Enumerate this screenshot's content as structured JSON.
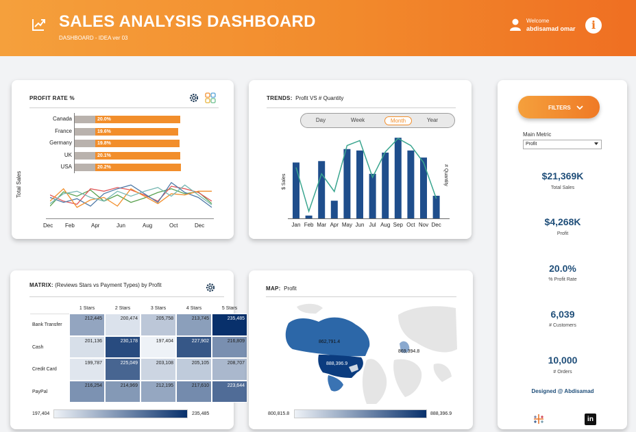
{
  "header": {
    "title": "SALES ANALYSIS DASHBOARD",
    "subtitle": "DASHBOARD - IDEA ver 03",
    "welcome": "Welcome",
    "username": "abdisamad omar",
    "info_icon": "i"
  },
  "profit_rate": {
    "title": "PROFIT RATE %",
    "countries": [
      "Canada",
      "France",
      "Germany",
      "UK",
      "USA"
    ],
    "labels": [
      "20.0%",
      "19.6%",
      "19.8%",
      "20.1%",
      "20.2%"
    ],
    "values": [
      20.0,
      19.6,
      19.8,
      20.1,
      20.2
    ],
    "xlabel_ticks": [
      "Dec",
      "Feb",
      "Apr",
      "Jun",
      "Aug",
      "Oct",
      "Dec"
    ],
    "ylabel": "Total Sales",
    "series_colors": [
      "#59a14f",
      "#e15759",
      "#4e79a7",
      "#f28e2b",
      "#76b7b2"
    ]
  },
  "trends": {
    "title_bold": "TRENDS:",
    "title_rest": "Profit VS  # Quantity",
    "segments": [
      "Day",
      "Week",
      "Month",
      "Year"
    ],
    "active_segment": "Month",
    "months": [
      "Jan",
      "Feb",
      "Mar",
      "Apr",
      "May",
      "Jun",
      "Jul",
      "Aug",
      "Sep",
      "Oct",
      "Nov",
      "Dec"
    ],
    "y_left_label": "$ Sales",
    "y_right_label": "# Quantity"
  },
  "matrix": {
    "title_bold": "MATRIX:",
    "title_rest": "(Reviews Stars vs Payment Types) by Profit",
    "columns": [
      "1 Stars",
      "2 Stars",
      "3 Stars",
      "4 Stars",
      "5 Stars"
    ],
    "rows": [
      "Bank Transfer",
      "Cash",
      "Credit Card",
      "PayPal"
    ],
    "values": [
      [
        "212,445",
        "200,474",
        "205,758",
        "213,745",
        "235,485"
      ],
      [
        "201,136",
        "230,178",
        "197,404",
        "227,902",
        "216,809"
      ],
      [
        "199,787",
        "225,049",
        "203,108",
        "205,105",
        "208,707"
      ],
      [
        "216,254",
        "214,969",
        "212,195",
        "217,610",
        "223,644"
      ]
    ],
    "legend_min": "197,404",
    "legend_max": "235,485"
  },
  "map": {
    "title_bold": "MAP:",
    "title_rest": "Profit",
    "label_canada": "862,791.4",
    "label_usa": "888,396.9",
    "label_europe": "869,394.8",
    "legend_min": "800,815.8",
    "legend_max": "888,396.9"
  },
  "filters": {
    "button_label": "FILTERS",
    "main_metric_label": "Main Metric",
    "main_metric_value": "Profit"
  },
  "kpis": [
    {
      "value": "$21,369K",
      "label": "Total Sales"
    },
    {
      "value": "$4,268K",
      "label": "Profit"
    },
    {
      "value": "20.0%",
      "label": "% Profit Rate"
    },
    {
      "value": "6,039",
      "label": "# Customers"
    },
    {
      "value": "10,000",
      "label": "# Orders"
    }
  ],
  "credit": "Designed @ Abdisamad",
  "chart_data": [
    {
      "type": "bar",
      "title": "PROFIT RATE %",
      "categories": [
        "Canada",
        "France",
        "Germany",
        "UK",
        "USA"
      ],
      "values": [
        20.0,
        19.6,
        19.8,
        20.1,
        20.2
      ],
      "orientation": "horizontal"
    },
    {
      "type": "bar",
      "title": "TRENDS: Profit VS # Quantity",
      "categories": [
        "Jan",
        "Feb",
        "Mar",
        "Apr",
        "May",
        "Jun",
        "Jul",
        "Aug",
        "Sep",
        "Oct",
        "Nov",
        "Dec"
      ],
      "series": [
        {
          "name": "$ Sales",
          "values": [
            79,
            4,
            81,
            25,
            98,
            96,
            63,
            93,
            114,
            96,
            86,
            32
          ]
        },
        {
          "name": "# Quantity",
          "values": [
            72,
            10,
            63,
            38,
            103,
            110,
            58,
            94,
            113,
            103,
            79,
            28
          ]
        }
      ],
      "grid": false
    },
    {
      "type": "line",
      "ylabel": "Total Sales",
      "categories": [
        "Dec",
        "Jan",
        "Feb",
        "Mar",
        "Apr",
        "May",
        "Jun",
        "Jul",
        "Aug",
        "Sep",
        "Oct",
        "Nov",
        "Dec"
      ],
      "series": [
        {
          "values": [
            22,
            45,
            38,
            48,
            30,
            40,
            28,
            35,
            44,
            50,
            42,
            45,
            26
          ]
        },
        {
          "values": [
            40,
            30,
            25,
            50,
            46,
            52,
            48,
            40,
            30,
            54,
            50,
            44,
            30
          ]
        },
        {
          "values": [
            36,
            28,
            34,
            22,
            42,
            50,
            56,
            42,
            28,
            60,
            44,
            36,
            20
          ]
        },
        {
          "values": [
            30,
            50,
            20,
            32,
            36,
            22,
            50,
            38,
            26,
            42,
            40,
            46,
            46
          ]
        },
        {
          "values": [
            26,
            42,
            46,
            36,
            30,
            46,
            38,
            46,
            52,
            38,
            56,
            40,
            24
          ]
        }
      ],
      "grid": false
    },
    {
      "type": "heatmap",
      "title": "MATRIX: (Reviews Stars vs Payment Types) by Profit",
      "x": [
        "1 Stars",
        "2 Stars",
        "3 Stars",
        "4 Stars",
        "5 Stars"
      ],
      "y": [
        "Bank Transfer",
        "Cash",
        "Credit Card",
        "PayPal"
      ],
      "values": [
        [
          212445,
          200474,
          205758,
          213745,
          235485
        ],
        [
          201136,
          230178,
          197404,
          227902,
          216809
        ],
        [
          199787,
          225049,
          203108,
          205105,
          208707
        ],
        [
          216254,
          214969,
          212195,
          217610,
          223644
        ]
      ],
      "range": [
        197404,
        235485
      ]
    }
  ]
}
